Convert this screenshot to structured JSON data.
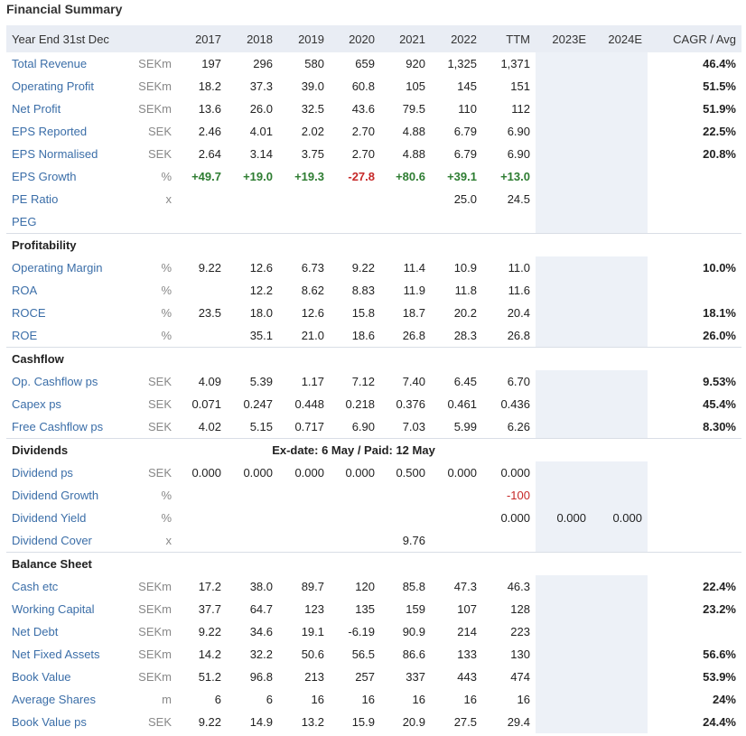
{
  "title": "Financial Summary",
  "colors": {
    "link": "#3b6ea8",
    "positive": "#2e7d32",
    "negative": "#c62828",
    "header_bg": "#e9edf4",
    "shade": "#edf1f7"
  },
  "header": {
    "label": "Year End 31st Dec",
    "years": [
      "2017",
      "2018",
      "2019",
      "2020",
      "2021",
      "2022",
      "TTM",
      "2023E",
      "2024E"
    ],
    "cagr": "CAGR / Avg"
  },
  "sections": [
    {
      "title": "",
      "rows": [
        {
          "label": "Total Revenue",
          "unit": "SEKm",
          "values": [
            "197",
            "296",
            "580",
            "659",
            "920",
            "1,325",
            "1,371",
            "",
            ""
          ],
          "cagr": "46.4%"
        },
        {
          "label": "Operating Profit",
          "unit": "SEKm",
          "values": [
            "18.2",
            "37.3",
            "39.0",
            "60.8",
            "105",
            "145",
            "151",
            "",
            ""
          ],
          "cagr": "51.5%"
        },
        {
          "label": "Net Profit",
          "unit": "SEKm",
          "values": [
            "13.6",
            "26.0",
            "32.5",
            "43.6",
            "79.5",
            "110",
            "112",
            "",
            ""
          ],
          "cagr": "51.9%"
        },
        {
          "label": "EPS Reported",
          "unit": "SEK",
          "values": [
            "2.46",
            "4.01",
            "2.02",
            "2.70",
            "4.88",
            "6.79",
            "6.90",
            "",
            ""
          ],
          "cagr": "22.5%"
        },
        {
          "label": "EPS Normalised",
          "unit": "SEK",
          "values": [
            "2.64",
            "3.14",
            "3.75",
            "2.70",
            "4.88",
            "6.79",
            "6.90",
            "",
            ""
          ],
          "cagr": "20.8%"
        },
        {
          "label": "EPS Growth",
          "unit": "%",
          "values": [
            "+49.7",
            "+19.0",
            "+19.3",
            "-27.8",
            "+80.6",
            "+39.1",
            "+13.0",
            "",
            ""
          ],
          "cagr": "",
          "style": "growth"
        },
        {
          "label": "PE Ratio",
          "unit": "x",
          "values": [
            "",
            "",
            "",
            "",
            "",
            "25.0",
            "24.5",
            "",
            ""
          ],
          "cagr": ""
        },
        {
          "label": "PEG",
          "unit": "",
          "values": [
            "",
            "",
            "",
            "",
            "",
            "",
            "",
            "",
            ""
          ],
          "cagr": ""
        }
      ]
    },
    {
      "title": "Profitability",
      "rows": [
        {
          "label": "Operating Margin",
          "unit": "%",
          "values": [
            "9.22",
            "12.6",
            "6.73",
            "9.22",
            "11.4",
            "10.9",
            "11.0",
            "",
            ""
          ],
          "cagr": "10.0%"
        },
        {
          "label": "ROA",
          "unit": "%",
          "values": [
            "",
            "12.2",
            "8.62",
            "8.83",
            "11.9",
            "11.8",
            "11.6",
            "",
            ""
          ],
          "cagr": ""
        },
        {
          "label": "ROCE",
          "unit": "%",
          "values": [
            "23.5",
            "18.0",
            "12.6",
            "15.8",
            "18.7",
            "20.2",
            "20.4",
            "",
            ""
          ],
          "cagr": "18.1%"
        },
        {
          "label": "ROE",
          "unit": "%",
          "values": [
            "",
            "35.1",
            "21.0",
            "18.6",
            "26.8",
            "28.3",
            "26.8",
            "",
            ""
          ],
          "cagr": "26.0%"
        }
      ]
    },
    {
      "title": "Cashflow",
      "rows": [
        {
          "label": "Op. Cashflow ps",
          "unit": "SEK",
          "values": [
            "4.09",
            "5.39",
            "1.17",
            "7.12",
            "7.40",
            "6.45",
            "6.70",
            "",
            ""
          ],
          "cagr": "9.53%"
        },
        {
          "label": "Capex ps",
          "unit": "SEK",
          "values": [
            "0.071",
            "0.247",
            "0.448",
            "0.218",
            "0.376",
            "0.461",
            "0.436",
            "",
            ""
          ],
          "cagr": "45.4%"
        },
        {
          "label": "Free Cashflow ps",
          "unit": "SEK",
          "values": [
            "4.02",
            "5.15",
            "0.717",
            "6.90",
            "7.03",
            "5.99",
            "6.26",
            "",
            ""
          ],
          "cagr": "8.30%"
        }
      ]
    },
    {
      "title": "Dividends",
      "note": "Ex-date: 6 May / Paid: 12 May",
      "rows": [
        {
          "label": "Dividend ps",
          "unit": "SEK",
          "values": [
            "0.000",
            "0.000",
            "0.000",
            "0.000",
            "0.500",
            "0.000",
            "0.000",
            "",
            ""
          ],
          "cagr": ""
        },
        {
          "label": "Dividend Growth",
          "unit": "%",
          "values": [
            "",
            "",
            "",
            "",
            "",
            "",
            "-100",
            "",
            ""
          ],
          "cagr": "",
          "red_ttm": true
        },
        {
          "label": "Dividend Yield",
          "unit": "%",
          "values": [
            "",
            "",
            "",
            "",
            "",
            "",
            "0.000",
            "0.000",
            "0.000"
          ],
          "cagr": ""
        },
        {
          "label": "Dividend Cover",
          "unit": "x",
          "values": [
            "",
            "",
            "",
            "",
            "9.76",
            "",
            "",
            "",
            ""
          ],
          "cagr": ""
        }
      ]
    },
    {
      "title": "Balance Sheet",
      "rows": [
        {
          "label": "Cash etc",
          "unit": "SEKm",
          "values": [
            "17.2",
            "38.0",
            "89.7",
            "120",
            "85.8",
            "47.3",
            "46.3",
            "",
            ""
          ],
          "cagr": "22.4%"
        },
        {
          "label": "Working Capital",
          "unit": "SEKm",
          "values": [
            "37.7",
            "64.7",
            "123",
            "135",
            "159",
            "107",
            "128",
            "",
            ""
          ],
          "cagr": "23.2%"
        },
        {
          "label": "Net Debt",
          "unit": "SEKm",
          "values": [
            "9.22",
            "34.6",
            "19.1",
            "-6.19",
            "90.9",
            "214",
            "223",
            "",
            ""
          ],
          "cagr": ""
        },
        {
          "label": "Net Fixed Assets",
          "unit": "SEKm",
          "values": [
            "14.2",
            "32.2",
            "50.6",
            "56.5",
            "86.6",
            "133",
            "130",
            "",
            ""
          ],
          "cagr": "56.6%"
        },
        {
          "label": "Book Value",
          "unit": "SEKm",
          "values": [
            "51.2",
            "96.8",
            "213",
            "257",
            "337",
            "443",
            "474",
            "",
            ""
          ],
          "cagr": "53.9%"
        },
        {
          "label": "Average Shares",
          "unit": "m",
          "values": [
            "6",
            "6",
            "16",
            "16",
            "16",
            "16",
            "16",
            "",
            ""
          ],
          "cagr": "24%"
        },
        {
          "label": "Book Value ps",
          "unit": "SEK",
          "values": [
            "9.22",
            "14.9",
            "13.2",
            "15.9",
            "20.9",
            "27.5",
            "29.4",
            "",
            ""
          ],
          "cagr": "24.4%"
        }
      ]
    }
  ]
}
